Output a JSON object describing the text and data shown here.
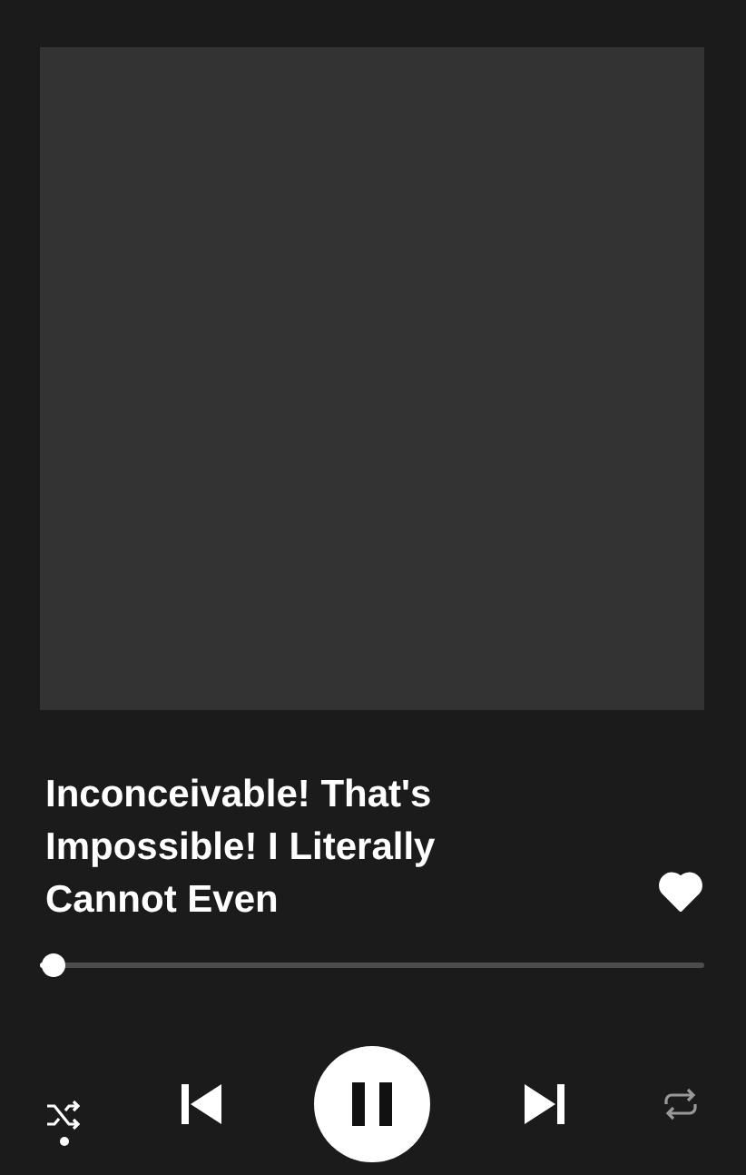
{
  "track": {
    "title": "Inconceivable! That's Impossible! I Literally Cannot Even",
    "liked": true
  },
  "progress": {
    "level": 0.02
  },
  "controls": {
    "shuffle": true,
    "repeat": false,
    "playing": true
  }
}
